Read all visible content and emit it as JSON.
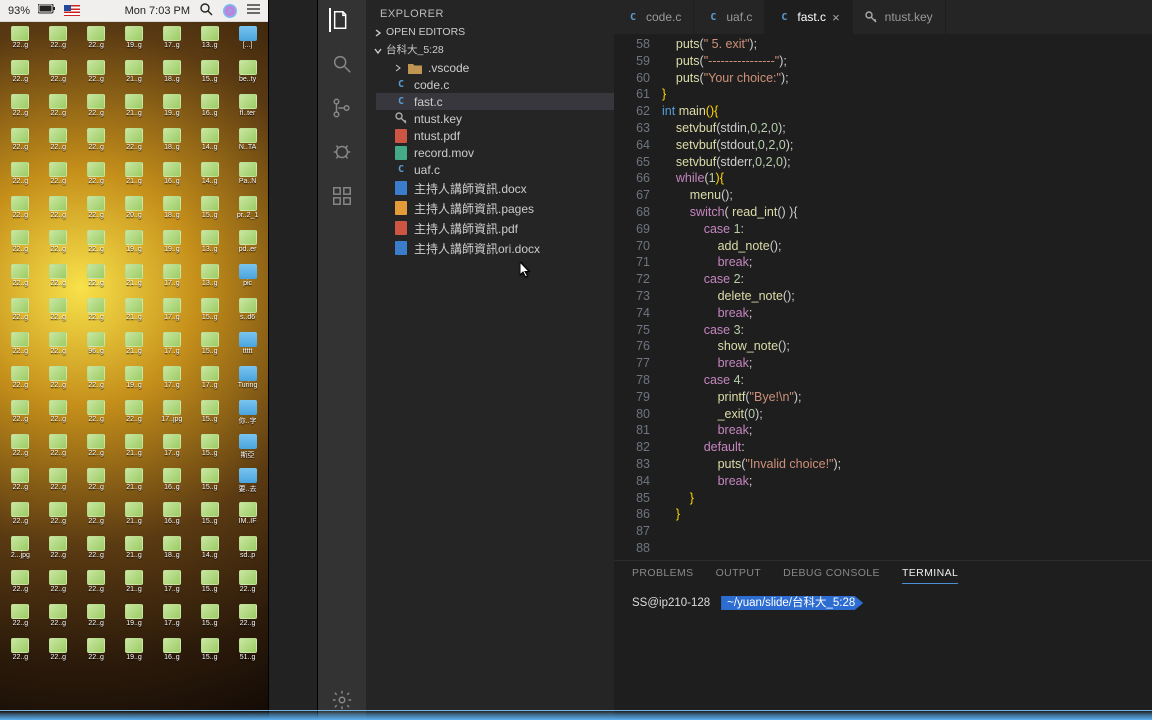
{
  "menubar": {
    "battery_pct": "93%",
    "clock": "Mon 7:03 PM"
  },
  "desktop_files": [
    "22..g",
    "22..g",
    "22..g",
    "19..g",
    "17..g",
    "13..g",
    "[...]",
    "22..g",
    "22..g",
    "22..g",
    "21..g",
    "18..g",
    "15..g",
    "be..ty",
    "22..g",
    "22..g",
    "22..g",
    "21..g",
    "19..g",
    "16..g",
    "fl..ter",
    "22..g",
    "22..g",
    "22..g",
    "22..g",
    "18..g",
    "14..g",
    "N..TA",
    "22..g",
    "22..g",
    "22..g",
    "21..g",
    "16..g",
    "14..g",
    "Pa..N",
    "22..g",
    "22..g",
    "22..g",
    "20..g",
    "18..g",
    "15..g",
    "pr..2_1",
    "22..g",
    "22..g",
    "22..g",
    "19..g",
    "19..g",
    "13..g",
    "pd..er",
    "22..g",
    "22..g",
    "22..g",
    "21..g",
    "17..g",
    "13..g",
    "pic",
    "22..g",
    "22..g",
    "22..g",
    "21..g",
    "17..g",
    "15..g",
    "s..d6",
    "22..g",
    "22..g",
    "96..g",
    "21..g",
    "17..g",
    "15..g",
    "ttttt",
    "22..g",
    "22..g",
    "22..g",
    "19..g",
    "17..g",
    "17..g",
    "Turing",
    "22..g",
    "22..g",
    "22..g",
    "22..g",
    "17..jpg",
    "15..g",
    "你..字",
    "22..g",
    "22..g",
    "22..g",
    "21..g",
    "17..g",
    "15..g",
    "斯亞",
    "22..g",
    "22..g",
    "22..g",
    "21..g",
    "16..g",
    "15..g",
    "要..去",
    "22..g",
    "22..g",
    "22..g",
    "21..g",
    "16..g",
    "15..g",
    "IM..IF",
    "2...jpg",
    "22..g",
    "22..g",
    "21..g",
    "18..g",
    "14..g",
    "sd..p",
    "22..g",
    "22..g",
    "22..g",
    "21..g",
    "17..g",
    "15..g",
    "22..g",
    "22..g",
    "22..g",
    "22..g",
    "19..g",
    "17..g",
    "15..g",
    "22..g",
    "22..g",
    "22..g",
    "22..g",
    "19..g",
    "16..g",
    "15..g",
    "51..g"
  ],
  "explorer": {
    "title": "EXPLORER",
    "open_editors": "OPEN EDITORS",
    "workspace": "台科大_5:28",
    "tree": [
      {
        "type": "folder",
        "label": ".vscode",
        "icon": "folder"
      },
      {
        "type": "file",
        "label": "code.c",
        "icon": "c"
      },
      {
        "type": "file",
        "label": "fast.c",
        "icon": "c",
        "active": true
      },
      {
        "type": "file",
        "label": "ntust.key",
        "icon": "key"
      },
      {
        "type": "file",
        "label": "ntust.pdf",
        "icon": "pdf"
      },
      {
        "type": "file",
        "label": "record.mov",
        "icon": "mov"
      },
      {
        "type": "file",
        "label": "uaf.c",
        "icon": "c"
      },
      {
        "type": "file",
        "label": "主持人講師資訊.docx",
        "icon": "doc"
      },
      {
        "type": "file",
        "label": "主持人講師資訊.pages",
        "icon": "pages"
      },
      {
        "type": "file",
        "label": "主持人講師資訊.pdf",
        "icon": "pdf"
      },
      {
        "type": "file",
        "label": "主持人講師資訊ori.docx",
        "icon": "doc"
      }
    ]
  },
  "tabs": [
    {
      "label": "code.c",
      "icon": "c",
      "active": false
    },
    {
      "label": "uaf.c",
      "icon": "c",
      "active": false
    },
    {
      "label": "fast.c",
      "icon": "c",
      "active": true,
      "closeable": true
    },
    {
      "label": "ntust.key",
      "icon": "key",
      "active": false
    }
  ],
  "gutter_start": 58,
  "code_lines": [
    {
      "n": 58,
      "tokens": [
        [
          "    ",
          ""
        ],
        [
          "puts",
          "fn"
        ],
        [
          "(",
          "pn"
        ],
        [
          "\" 5. exit\"",
          "str"
        ],
        [
          ");",
          "pn"
        ]
      ]
    },
    {
      "n": 59,
      "tokens": [
        [
          "    ",
          ""
        ],
        [
          "puts",
          "fn"
        ],
        [
          "(",
          "pn"
        ],
        [
          "\"----------------\"",
          "str"
        ],
        [
          ");",
          "pn"
        ]
      ]
    },
    {
      "n": 60,
      "tokens": [
        [
          "    ",
          ""
        ],
        [
          "puts",
          "fn"
        ],
        [
          "(",
          "pn"
        ],
        [
          "\"Your choice:\"",
          "str"
        ],
        [
          ");",
          "pn"
        ]
      ]
    },
    {
      "n": 61,
      "tokens": [
        [
          "}",
          "br"
        ]
      ]
    },
    {
      "n": 62,
      "tokens": [
        [
          "",
          ""
        ]
      ]
    },
    {
      "n": 63,
      "tokens": [
        [
          "int ",
          "ty"
        ],
        [
          "main",
          "fn"
        ],
        [
          "(){",
          "br"
        ]
      ]
    },
    {
      "n": 64,
      "tokens": [
        [
          "    ",
          ""
        ],
        [
          "setvbuf",
          "fn"
        ],
        [
          "(",
          "pn"
        ],
        [
          "stdin,",
          "pn"
        ],
        [
          "0",
          "num"
        ],
        [
          ",",
          "pn"
        ],
        [
          "2",
          "num"
        ],
        [
          ",",
          "pn"
        ],
        [
          "0",
          "num"
        ],
        [
          ");",
          "pn"
        ]
      ]
    },
    {
      "n": 65,
      "tokens": [
        [
          "    ",
          ""
        ],
        [
          "setvbuf",
          "fn"
        ],
        [
          "(",
          "pn"
        ],
        [
          "stdout,",
          "pn"
        ],
        [
          "0",
          "num"
        ],
        [
          ",",
          "pn"
        ],
        [
          "2",
          "num"
        ],
        [
          ",",
          "pn"
        ],
        [
          "0",
          "num"
        ],
        [
          ");",
          "pn"
        ]
      ]
    },
    {
      "n": 66,
      "tokens": [
        [
          "    ",
          ""
        ],
        [
          "setvbuf",
          "fn"
        ],
        [
          "(",
          "pn"
        ],
        [
          "stderr,",
          "pn"
        ],
        [
          "0",
          "num"
        ],
        [
          ",",
          "pn"
        ],
        [
          "2",
          "num"
        ],
        [
          ",",
          "pn"
        ],
        [
          "0",
          "num"
        ],
        [
          ");",
          "pn"
        ]
      ]
    },
    {
      "n": 67,
      "tokens": [
        [
          "",
          ""
        ]
      ]
    },
    {
      "n": 68,
      "tokens": [
        [
          "    ",
          ""
        ],
        [
          "while",
          "kw"
        ],
        [
          "(",
          "pn"
        ],
        [
          "1",
          "num"
        ],
        [
          "){",
          "br"
        ]
      ]
    },
    {
      "n": 69,
      "tokens": [
        [
          "        ",
          ""
        ],
        [
          "menu",
          "fn"
        ],
        [
          "();",
          "pn"
        ]
      ]
    },
    {
      "n": 70,
      "tokens": [
        [
          "        ",
          ""
        ],
        [
          "switch",
          "kw"
        ],
        [
          "( ",
          "pn"
        ],
        [
          "read_int",
          "fn"
        ],
        [
          "() ){",
          "pn"
        ]
      ]
    },
    {
      "n": 71,
      "tokens": [
        [
          "            ",
          ""
        ],
        [
          "case ",
          "kw"
        ],
        [
          "1",
          "num"
        ],
        [
          ":",
          "pn"
        ]
      ]
    },
    {
      "n": 72,
      "tokens": [
        [
          "                ",
          ""
        ],
        [
          "add_note",
          "fn"
        ],
        [
          "();",
          "pn"
        ]
      ]
    },
    {
      "n": 73,
      "tokens": [
        [
          "                ",
          ""
        ],
        [
          "break",
          "kw"
        ],
        [
          ";",
          "pn"
        ]
      ]
    },
    {
      "n": 74,
      "tokens": [
        [
          "            ",
          ""
        ],
        [
          "case ",
          "kw"
        ],
        [
          "2",
          "num"
        ],
        [
          ":",
          "pn"
        ]
      ]
    },
    {
      "n": 75,
      "tokens": [
        [
          "                ",
          ""
        ],
        [
          "delete_note",
          "fn"
        ],
        [
          "();",
          "pn"
        ]
      ]
    },
    {
      "n": 76,
      "tokens": [
        [
          "                ",
          ""
        ],
        [
          "break",
          "kw"
        ],
        [
          ";",
          "pn"
        ]
      ]
    },
    {
      "n": 77,
      "tokens": [
        [
          "            ",
          ""
        ],
        [
          "case ",
          "kw"
        ],
        [
          "3",
          "num"
        ],
        [
          ":",
          "pn"
        ]
      ]
    },
    {
      "n": 78,
      "tokens": [
        [
          "                ",
          ""
        ],
        [
          "show_note",
          "fn"
        ],
        [
          "();",
          "pn"
        ]
      ]
    },
    {
      "n": 79,
      "tokens": [
        [
          "                ",
          ""
        ],
        [
          "break",
          "kw"
        ],
        [
          ";",
          "pn"
        ]
      ]
    },
    {
      "n": 80,
      "tokens": [
        [
          "            ",
          ""
        ],
        [
          "case ",
          "kw"
        ],
        [
          "4",
          "num"
        ],
        [
          ":",
          "pn"
        ]
      ]
    },
    {
      "n": 81,
      "tokens": [
        [
          "                ",
          ""
        ],
        [
          "printf",
          "fn"
        ],
        [
          "(",
          "pn"
        ],
        [
          "\"Bye!\\n\"",
          "str"
        ],
        [
          ");",
          "pn"
        ]
      ]
    },
    {
      "n": 82,
      "tokens": [
        [
          "                ",
          ""
        ],
        [
          "_exit",
          "fn"
        ],
        [
          "(",
          "pn"
        ],
        [
          "0",
          "num"
        ],
        [
          ");",
          "pn"
        ]
      ]
    },
    {
      "n": 83,
      "tokens": [
        [
          "                ",
          ""
        ],
        [
          "break",
          "kw"
        ],
        [
          ";",
          "pn"
        ]
      ]
    },
    {
      "n": 84,
      "tokens": [
        [
          "            ",
          ""
        ],
        [
          "default",
          "kw"
        ],
        [
          ":",
          "pn"
        ]
      ]
    },
    {
      "n": 85,
      "tokens": [
        [
          "                ",
          ""
        ],
        [
          "puts",
          "fn"
        ],
        [
          "(",
          "pn"
        ],
        [
          "\"Invalid choice!\"",
          "str"
        ],
        [
          ");",
          "pn"
        ]
      ]
    },
    {
      "n": 86,
      "tokens": [
        [
          "                ",
          ""
        ],
        [
          "break",
          "kw"
        ],
        [
          ";",
          "pn"
        ]
      ]
    },
    {
      "n": 87,
      "tokens": [
        [
          "        }",
          "br"
        ]
      ]
    },
    {
      "n": 88,
      "tokens": [
        [
          "    }",
          "br"
        ]
      ]
    }
  ],
  "panel": {
    "tabs": [
      "PROBLEMS",
      "OUTPUT",
      "DEBUG CONSOLE",
      "TERMINAL"
    ],
    "active_tab": 3,
    "prompt_host": "SS@ip210-128",
    "prompt_path": "~/yuan/slide/台科大_5:28"
  }
}
